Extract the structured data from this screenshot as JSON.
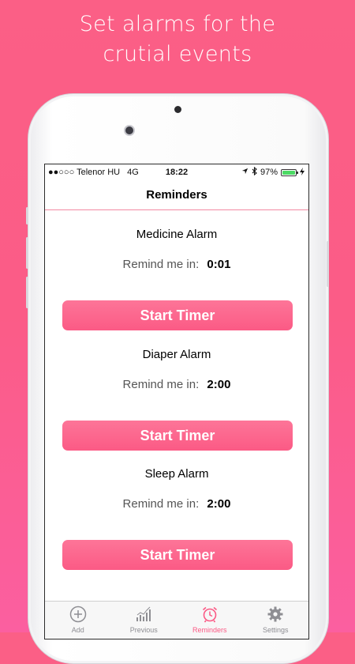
{
  "headline": {
    "line1": "Set alarms for the",
    "line2": "crutial events"
  },
  "status_bar": {
    "carrier": "●●○○○ Telenor HU",
    "network": "4G",
    "time": "18:22",
    "battery": "97%",
    "battery_level": 0.97
  },
  "nav": {
    "title": "Reminders"
  },
  "alarms": [
    {
      "title": "Medicine Alarm",
      "remind_label": "Remind me in:",
      "remind_value": "0:01",
      "button": "Start Timer"
    },
    {
      "title": "Diaper Alarm",
      "remind_label": "Remind me in:",
      "remind_value": "2:00",
      "button": "Start Timer"
    },
    {
      "title": "Sleep Alarm",
      "remind_label": "Remind me in:",
      "remind_value": "2:00",
      "button": "Start Timer"
    }
  ],
  "tabs": [
    {
      "label": "Add",
      "icon": "plus-circle-icon",
      "active": false
    },
    {
      "label": "Previous",
      "icon": "bar-chart-icon",
      "active": false
    },
    {
      "label": "Reminders",
      "icon": "alarm-clock-icon",
      "active": true
    },
    {
      "label": "Settings",
      "icon": "gear-icon",
      "active": false
    }
  ],
  "colors": {
    "accent": "#fb5a85",
    "background": "#fb5c87",
    "tab_inactive": "#8e8e93"
  }
}
